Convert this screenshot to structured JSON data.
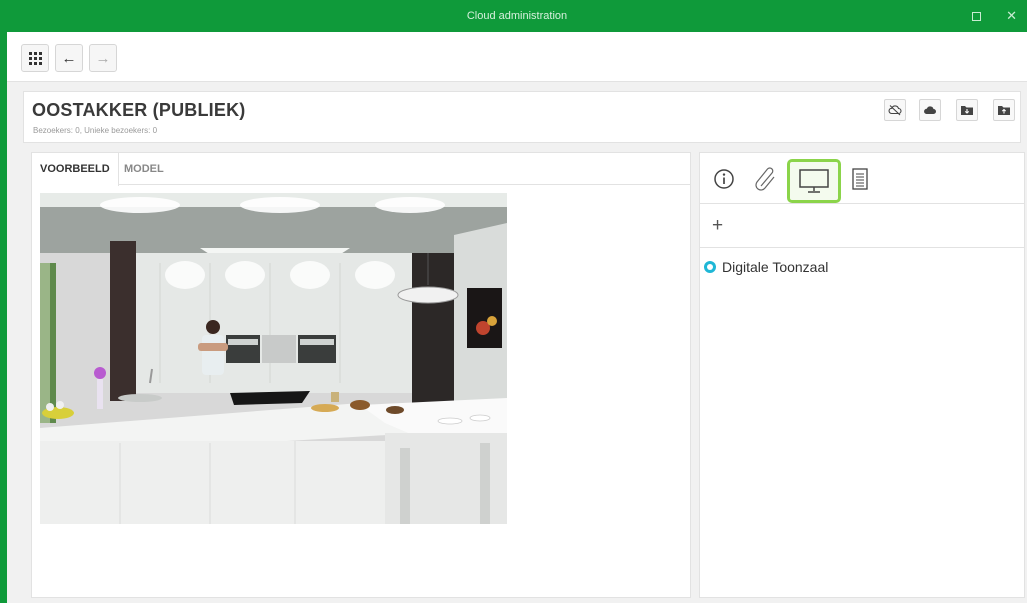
{
  "window": {
    "title": "Cloud administration",
    "accent_color": "#0f9a3a",
    "maximize_icon": "square-icon",
    "close_label": "✕"
  },
  "toolbar": {
    "apps_icon": "grid-icon",
    "back_label": "←",
    "forward_label": "→"
  },
  "header": {
    "title": "OOSTAKKER (PUBLIEK)",
    "subtitle": "Bezoekers: 0, Unieke bezoekers: 0",
    "actions": [
      "cloud-off-icon",
      "cloud-upload-icon",
      "folder-download-icon",
      "folder-upload-icon"
    ]
  },
  "left_panel": {
    "tabs": [
      {
        "label": "VOORBEELD",
        "active": true
      },
      {
        "label": "MODEL",
        "active": false
      }
    ],
    "preview_image": "kitchen-render-image"
  },
  "right_panel": {
    "tool_icons": [
      "info-icon",
      "paperclip-icon",
      "monitor-icon",
      "document-icon"
    ],
    "selected_tool": "monitor-icon",
    "highlight_color": "#8bd44a",
    "add_label": "+",
    "items": [
      {
        "label": "Digitale Toonzaal",
        "icon": "circle-icon",
        "color": "#1fb7d6"
      }
    ]
  }
}
